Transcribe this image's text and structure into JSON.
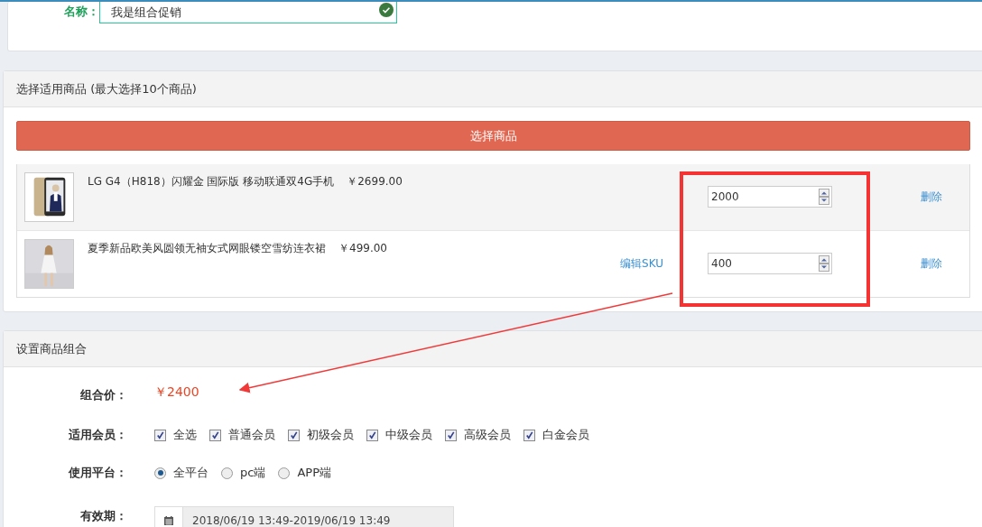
{
  "name_field": {
    "label": "名称：",
    "value": "我是组合促销",
    "valid": true
  },
  "product_section": {
    "title": "选择适用商品 (最大选择10个商品)",
    "select_button": "选择商品",
    "products": [
      {
        "name": "LG G4（H818）闪耀金 国际版 移动联通双4G手机",
        "price": "￥2699.00",
        "quantity": "2000",
        "delete": "删除",
        "kind": "phone"
      },
      {
        "name": "夏季新品欧美风圆领无袖女式网眼镂空雪纺连衣裙",
        "price": "￥499.00",
        "edit_sku": "编辑SKU",
        "quantity": "400",
        "delete": "删除",
        "kind": "dress"
      }
    ]
  },
  "combo_section": {
    "title": "设置商品组合",
    "price": {
      "label": "组合价：",
      "value": "￥2400"
    },
    "members": {
      "label": "适用会员：",
      "options": [
        {
          "label": "全选",
          "checked": true
        },
        {
          "label": "普通会员",
          "checked": true
        },
        {
          "label": "初级会员",
          "checked": true
        },
        {
          "label": "中级会员",
          "checked": true
        },
        {
          "label": "高级会员",
          "checked": true
        },
        {
          "label": "白金会员",
          "checked": true
        }
      ]
    },
    "platform": {
      "label": "使用平台：",
      "options": [
        {
          "label": "全平台",
          "selected": true
        },
        {
          "label": "pc端",
          "selected": false
        },
        {
          "label": "APP端",
          "selected": false
        }
      ]
    },
    "validity": {
      "label": "有效期：",
      "value": "2018/06/19 13:49-2019/06/19 13:49"
    }
  }
}
